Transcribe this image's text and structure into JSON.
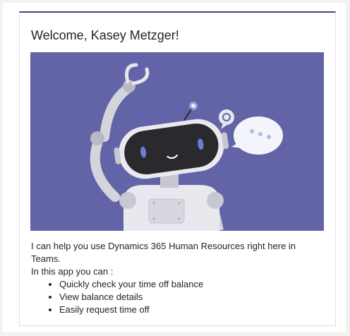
{
  "card": {
    "title": "Welcome, Kasey Metzger!",
    "hero_image": "robot-illustration",
    "intro": "I can help you use Dynamics 365 Human Resources right here in Teams.",
    "list_heading": "In this app you can :",
    "features": [
      "Quickly check your time off balance",
      "View balance details",
      "Easily request time off"
    ]
  },
  "colors": {
    "accent_bar": "#464775",
    "hero_background": "#6264a7",
    "text": "#252423"
  }
}
